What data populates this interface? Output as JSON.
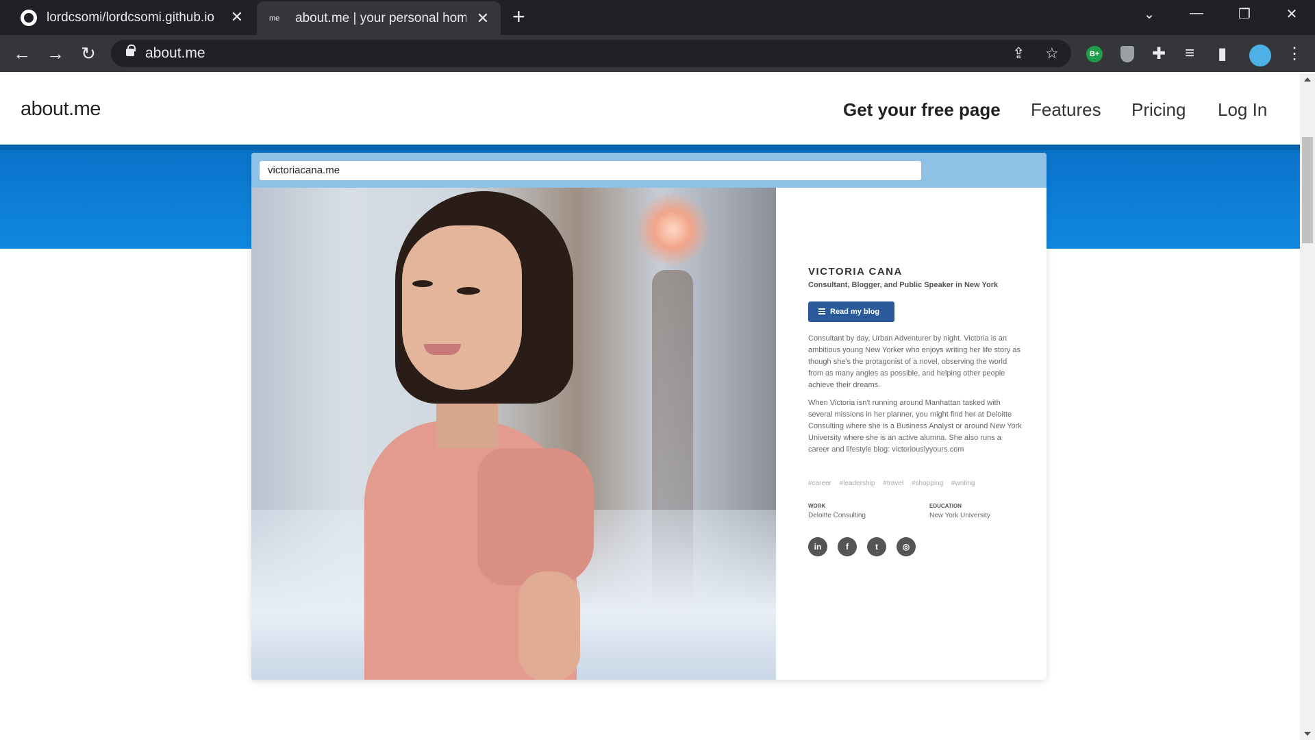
{
  "browser": {
    "tabs": [
      {
        "title": "lordcsomi/lordcsomi.github.io",
        "favicon": "github-icon",
        "active": false
      },
      {
        "title": "about.me | your personal homep",
        "favicon_text": "me",
        "active": true
      }
    ],
    "address": "about.me",
    "extensions": {
      "bplus_label": "B+"
    }
  },
  "site": {
    "logo": "about.me",
    "nav": {
      "cta": "Get your free page",
      "features": "Features",
      "pricing": "Pricing",
      "login": "Log In"
    }
  },
  "mockup": {
    "url": "victoriacana.me",
    "profile": {
      "name": "VICTORIA CANA",
      "tagline": "Consultant, Blogger, and Public Speaker in New York",
      "button_label": "Read my blog",
      "bio_1": "Consultant by day, Urban Adventurer by night. Victoria is an ambitious young New Yorker who enjoys writing her life story as though she's the protagonist of a novel, observing the world from as many angles as possible, and helping other people achieve their dreams.",
      "bio_2": "When Victoria isn't running around Manhattan tasked with several missions in her planner, you might find her at Deloitte Consulting where she is a Business Analyst or around New York University where she is an active alumna. She also runs a career and lifestyle blog: victoriouslyyours.com",
      "tags": [
        "#career",
        "#leadership",
        "#travel",
        "#shopping",
        "#writing"
      ],
      "work_label": "WORK",
      "work_value": "Deloitte Consulting",
      "education_label": "EDUCATION",
      "education_value": "New York University",
      "social": [
        {
          "name": "linkedin-icon",
          "glyph": "in"
        },
        {
          "name": "facebook-icon",
          "glyph": "f"
        },
        {
          "name": "twitter-icon",
          "glyph": "t"
        },
        {
          "name": "instagram-icon",
          "glyph": "◎"
        }
      ]
    }
  },
  "colors": {
    "hero_blue": "#0a72c9",
    "button_blue": "#2a5a99",
    "chrome_dark": "#202124"
  }
}
